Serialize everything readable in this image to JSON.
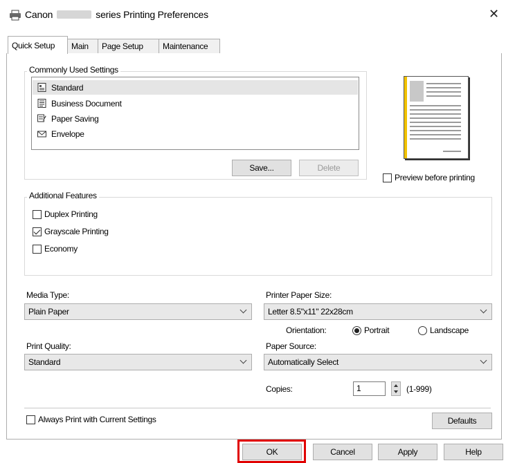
{
  "window": {
    "title_prefix": "Canon",
    "title_suffix": "series Printing Preferences",
    "close_label": "✕"
  },
  "tabs": [
    {
      "label": "Quick Setup",
      "active": true
    },
    {
      "label": "Main",
      "active": false
    },
    {
      "label": "Page Setup",
      "active": false
    },
    {
      "label": "Maintenance",
      "active": false
    }
  ],
  "commonly_used": {
    "group_label": "Commonly Used Settings",
    "items": [
      {
        "label": "Standard",
        "icon": "standard-doc-icon",
        "selected": true
      },
      {
        "label": "Business Document",
        "icon": "business-doc-icon",
        "selected": false
      },
      {
        "label": "Paper Saving",
        "icon": "paper-saving-icon",
        "selected": false
      },
      {
        "label": "Envelope",
        "icon": "envelope-icon",
        "selected": false
      }
    ],
    "save_label": "Save...",
    "delete_label": "Delete"
  },
  "preview": {
    "checkbox_label": "Preview before printing",
    "checked": false
  },
  "additional_features": {
    "group_label": "Additional Features",
    "items": [
      {
        "label": "Duplex Printing",
        "checked": false
      },
      {
        "label": "Grayscale Printing",
        "checked": true
      },
      {
        "label": "Economy",
        "checked": false
      }
    ]
  },
  "media_type": {
    "label": "Media Type:",
    "value": "Plain Paper"
  },
  "print_quality": {
    "label": "Print Quality:",
    "value": "Standard"
  },
  "paper_size": {
    "label": "Printer Paper Size:",
    "value": "Letter 8.5\"x11\" 22x28cm"
  },
  "orientation": {
    "label": "Orientation:",
    "portrait_label": "Portrait",
    "landscape_label": "Landscape",
    "selected": "Portrait"
  },
  "paper_source": {
    "label": "Paper Source:",
    "value": "Automatically Select"
  },
  "copies": {
    "label": "Copies:",
    "value": "1",
    "range": "(1-999)"
  },
  "always_print": {
    "label": "Always Print with Current Settings",
    "checked": false
  },
  "defaults_label": "Defaults",
  "footer": {
    "ok_label": "OK",
    "cancel_label": "Cancel",
    "apply_label": "Apply",
    "help_label": "Help"
  },
  "colors": {
    "highlight": "#e00000",
    "preview_accent": "#f2c200"
  }
}
